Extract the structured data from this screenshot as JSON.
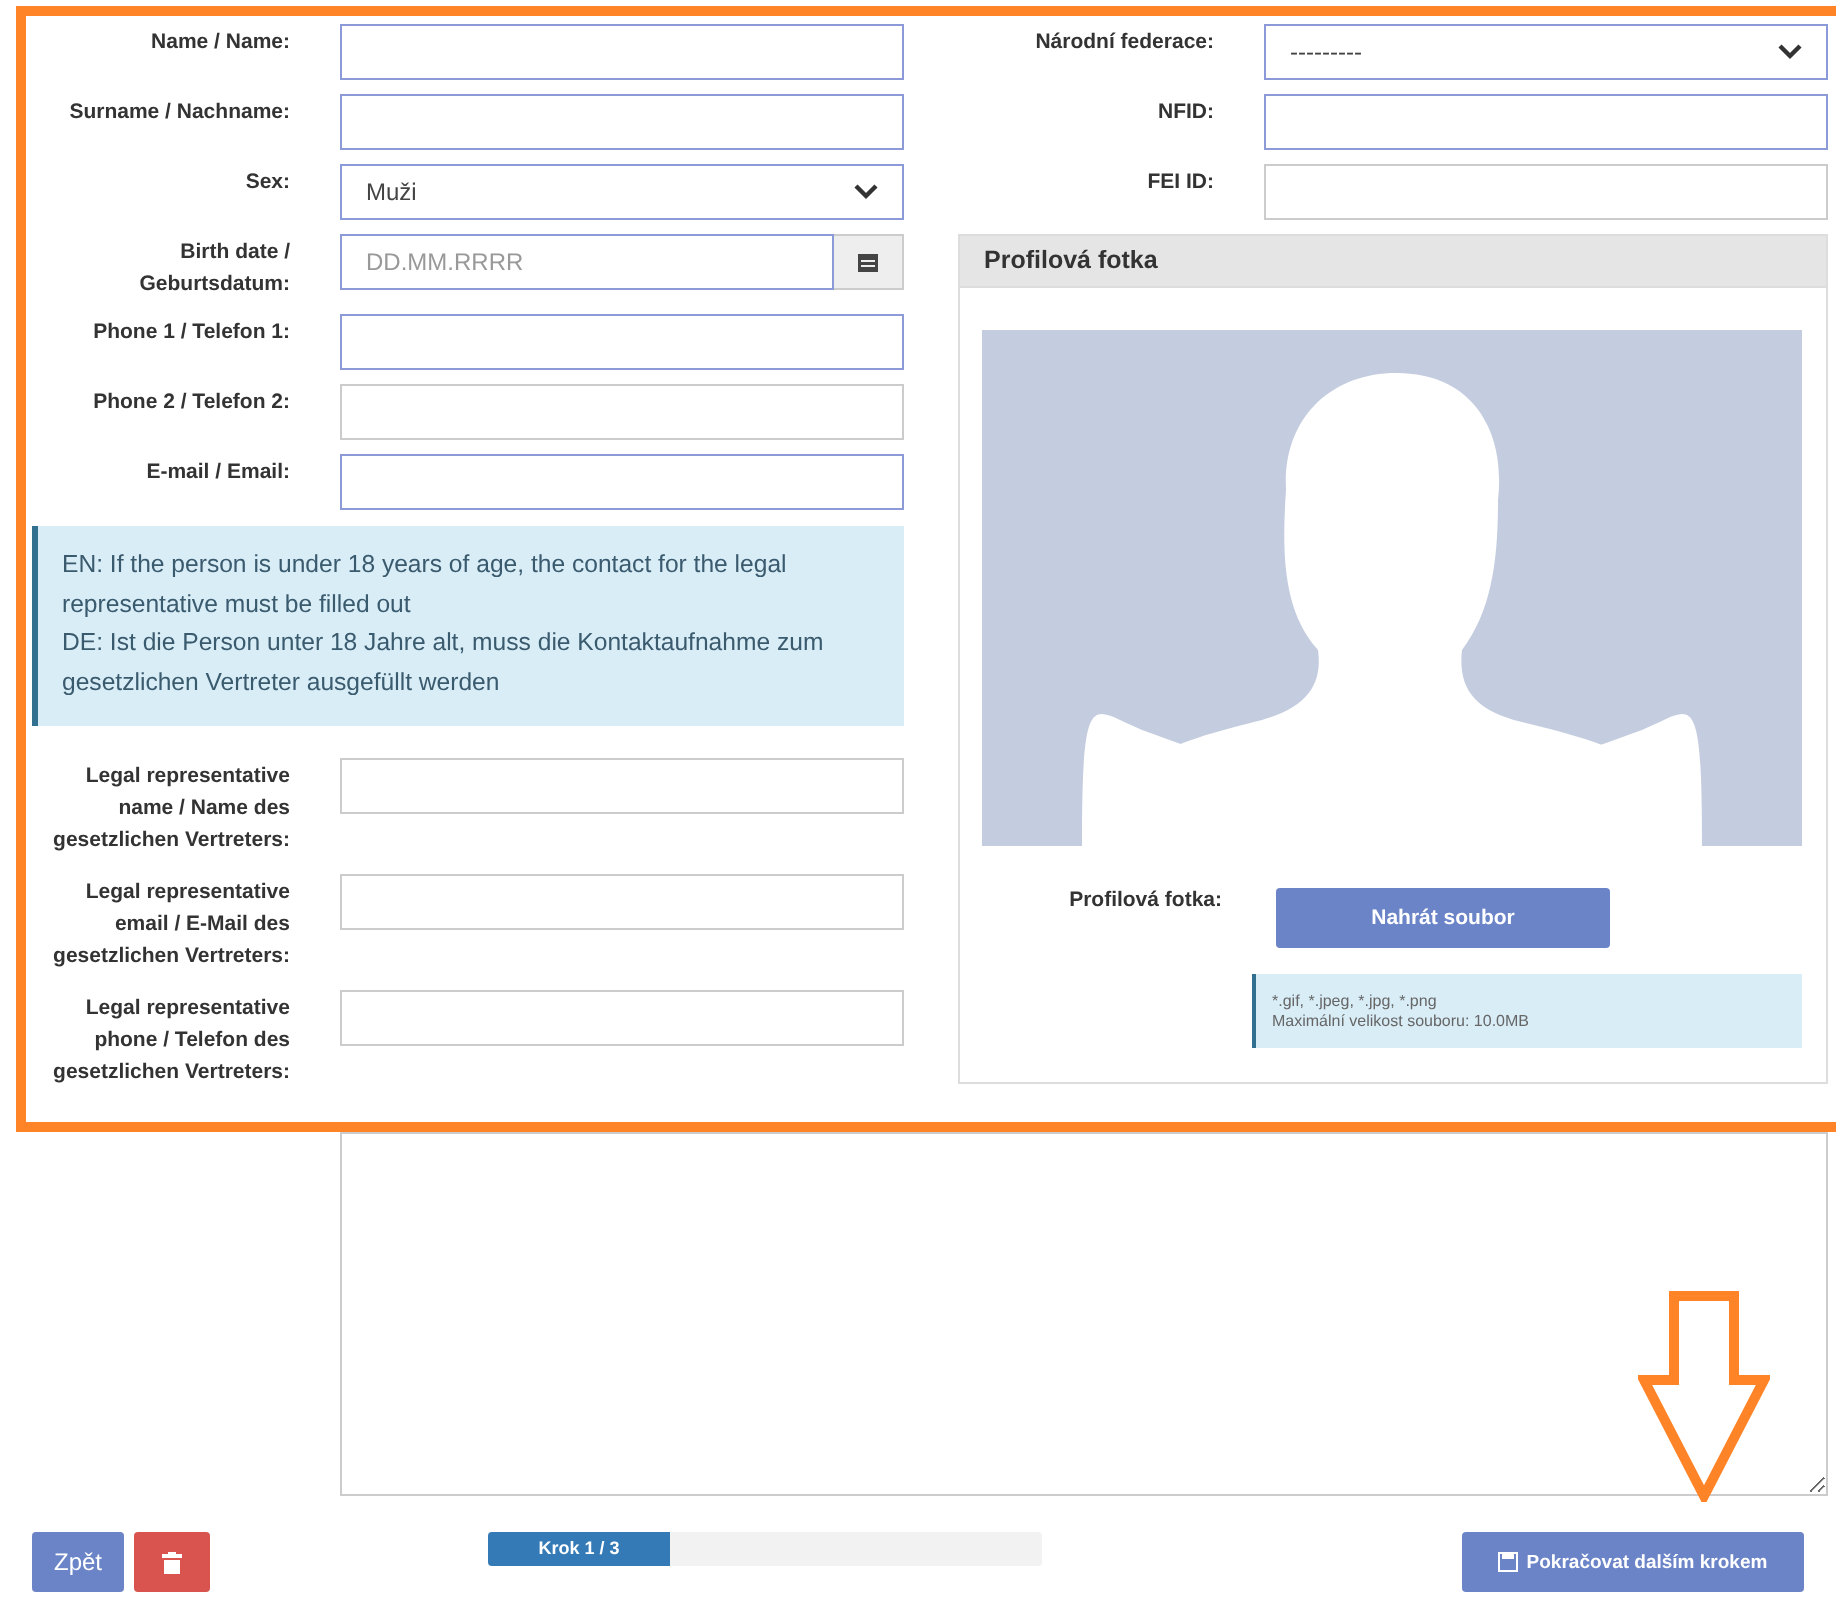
{
  "left_fields": [
    {
      "label": "Name / Name:",
      "kind": "text",
      "required": true
    },
    {
      "label": "Surname / Nachname:",
      "kind": "text",
      "required": true
    },
    {
      "label": "Sex:",
      "kind": "select",
      "value": "Muži",
      "required": true
    },
    {
      "label": "Birth date / Geburtsdatum:",
      "kind": "date",
      "placeholder": "DD.MM.RRRR",
      "required": true
    },
    {
      "label": "Phone 1 / Telefon 1:",
      "kind": "text",
      "required": true
    },
    {
      "label": "Phone 2 / Telefon 2:",
      "kind": "text",
      "required": false
    },
    {
      "label": "E-mail / Email:",
      "kind": "text",
      "required": true
    }
  ],
  "notice": [
    "EN: If the person is under 18 years of age, the contact for the legal representative must be filled out",
    "DE: Ist die Person unter 18 Jahre alt, muss die Kontaktaufnahme zum gesetzlichen Vertreter ausgefüllt werden"
  ],
  "legal_fields": [
    {
      "label": "Legal representative name / Name des gesetzlichen Vertreters:",
      "kind": "text",
      "required": false
    },
    {
      "label": "Legal representative email / E-Mail des gesetzlichen Vertreters:",
      "kind": "text",
      "required": false
    },
    {
      "label": "Legal representative phone / Telefon des gesetzlichen Vertreters:",
      "kind": "text",
      "required": false
    }
  ],
  "right_fields": [
    {
      "label": "Národní federace:",
      "kind": "select",
      "value": "---------",
      "required": true
    },
    {
      "label": "NFID:",
      "kind": "text",
      "required": true
    },
    {
      "label": "FEI ID:",
      "kind": "text",
      "required": false
    }
  ],
  "profile_photo": {
    "title": "Profilová fotka",
    "label": "Profilová fotka:",
    "upload_button": "Nahrát soubor",
    "hint_lines": [
      "*.gif, *.jpeg, *.jpg, *.png",
      "Maximální velikost souboru: 10.0MB"
    ]
  },
  "footer": {
    "back_button": "Zpět",
    "progress": {
      "label": "Krok 1 / 3",
      "level": 0.33
    },
    "continue_button": "Pokračovat dalším krokem"
  }
}
